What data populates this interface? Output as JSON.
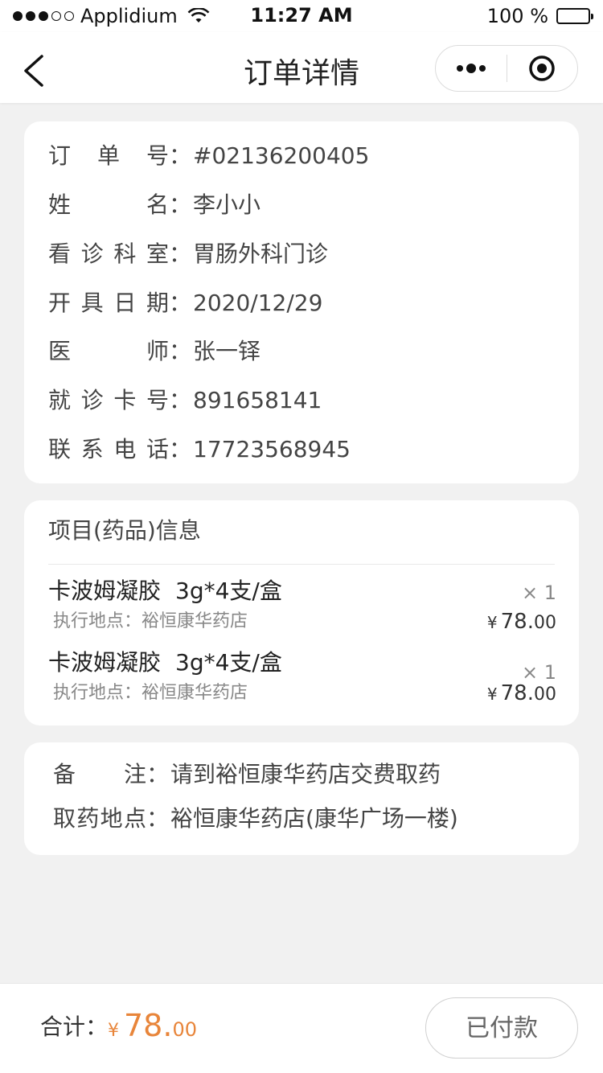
{
  "status_bar": {
    "carrier": "Applidium",
    "time": "11:27 AM",
    "battery": "100 %"
  },
  "nav": {
    "title": "订单详情",
    "back_icon": "chevron-left-icon",
    "more_icon": "more-dots-icon",
    "close_icon": "target-circle-icon"
  },
  "order_info": [
    {
      "label": "订单号",
      "colon": "：",
      "value": "#02136200405"
    },
    {
      "label": "姓名",
      "colon": "：",
      "value": "李小小"
    },
    {
      "label": "看诊科室",
      "colon": "：",
      "value": "胃肠外科门诊"
    },
    {
      "label": "开具日期",
      "colon": "：",
      "value": "2020/12/29"
    },
    {
      "label": "医师",
      "colon": "：",
      "value": "张一铎"
    },
    {
      "label": "就诊卡号",
      "colon": "：",
      "value": "891658141"
    },
    {
      "label": "联系电话",
      "colon": "：",
      "value": "17723568945"
    }
  ],
  "items_section": {
    "title": "项目(药品)信息",
    "items": [
      {
        "name": "卡波姆凝胶",
        "spec": "3g*4支/盒",
        "location": "执行地点：裕恒康华药店",
        "qty": "× 1",
        "price_yen": "¥",
        "price_int": "78.",
        "price_dec": "00"
      },
      {
        "name": "卡波姆凝胶",
        "spec": "3g*4支/盒",
        "location": "执行地点：裕恒康华药店",
        "qty": "× 1",
        "price_yen": "¥",
        "price_int": "78.",
        "price_dec": "00"
      }
    ]
  },
  "notes": [
    {
      "label": "备注",
      "colon": "：",
      "value": "请到裕恒康华药店交费取药"
    },
    {
      "label": "取药地点",
      "colon": "：",
      "value": "裕恒康华药店(康华广场一楼)"
    }
  ],
  "footer": {
    "total_label": "合计：",
    "total_yen": "¥",
    "total_int": "78.",
    "total_dec": "00",
    "paid_button": "已付款"
  },
  "colors": {
    "accent": "#e8853a",
    "background": "#f1f1f1",
    "card": "#ffffff"
  }
}
